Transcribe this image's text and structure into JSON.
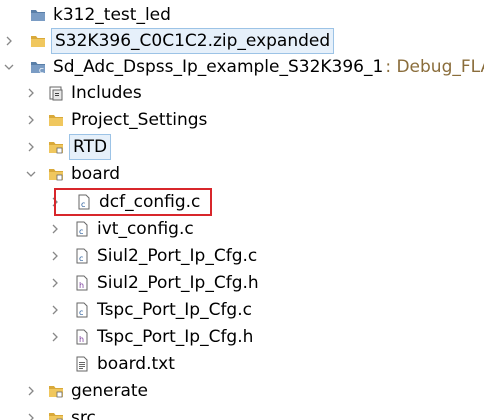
{
  "tree": {
    "items": [
      {
        "label": "k312_test_led",
        "icon": "project-folder-icon",
        "chevron": ""
      },
      {
        "label": "S32K396_C0C1C2.zip_expanded",
        "icon": "folder-icon",
        "chevron": "collapsed"
      },
      {
        "label": "Sd_Adc_Dspss_Ip_example_S32K396_1",
        "decoration": ": Debug_FLA",
        "icon": "project-folder-icon",
        "chevron": "expanded"
      },
      {
        "label": "Includes",
        "icon": "includes-icon",
        "chevron": "collapsed"
      },
      {
        "label": "Project_Settings",
        "icon": "folder-icon",
        "chevron": "collapsed"
      },
      {
        "label": "RTD",
        "icon": "source-folder-icon",
        "chevron": "collapsed"
      },
      {
        "label": "board",
        "icon": "source-folder-icon",
        "chevron": "expanded"
      },
      {
        "label": "dcf_config.c",
        "icon": "c-file-icon",
        "chevron": "collapsed"
      },
      {
        "label": "ivt_config.c",
        "icon": "c-file-icon",
        "chevron": "collapsed"
      },
      {
        "label": "Siul2_Port_Ip_Cfg.c",
        "icon": "c-file-icon",
        "chevron": "collapsed"
      },
      {
        "label": "Siul2_Port_Ip_Cfg.h",
        "icon": "h-file-icon",
        "chevron": "collapsed"
      },
      {
        "label": "Tspc_Port_Ip_Cfg.c",
        "icon": "c-file-icon",
        "chevron": "collapsed"
      },
      {
        "label": "Tspc_Port_Ip_Cfg.h",
        "icon": "h-file-icon",
        "chevron": "collapsed"
      },
      {
        "label": "board.txt",
        "icon": "text-file-icon",
        "chevron": ""
      },
      {
        "label": "generate",
        "icon": "source-folder-icon",
        "chevron": "collapsed"
      },
      {
        "label": "src",
        "icon": "source-folder-icon",
        "chevron": "collapsed"
      }
    ]
  },
  "colors": {
    "highlight_border": "#d8262b",
    "selection_border": "#9cc3e6",
    "decoration_text": "#8a6d3b"
  }
}
